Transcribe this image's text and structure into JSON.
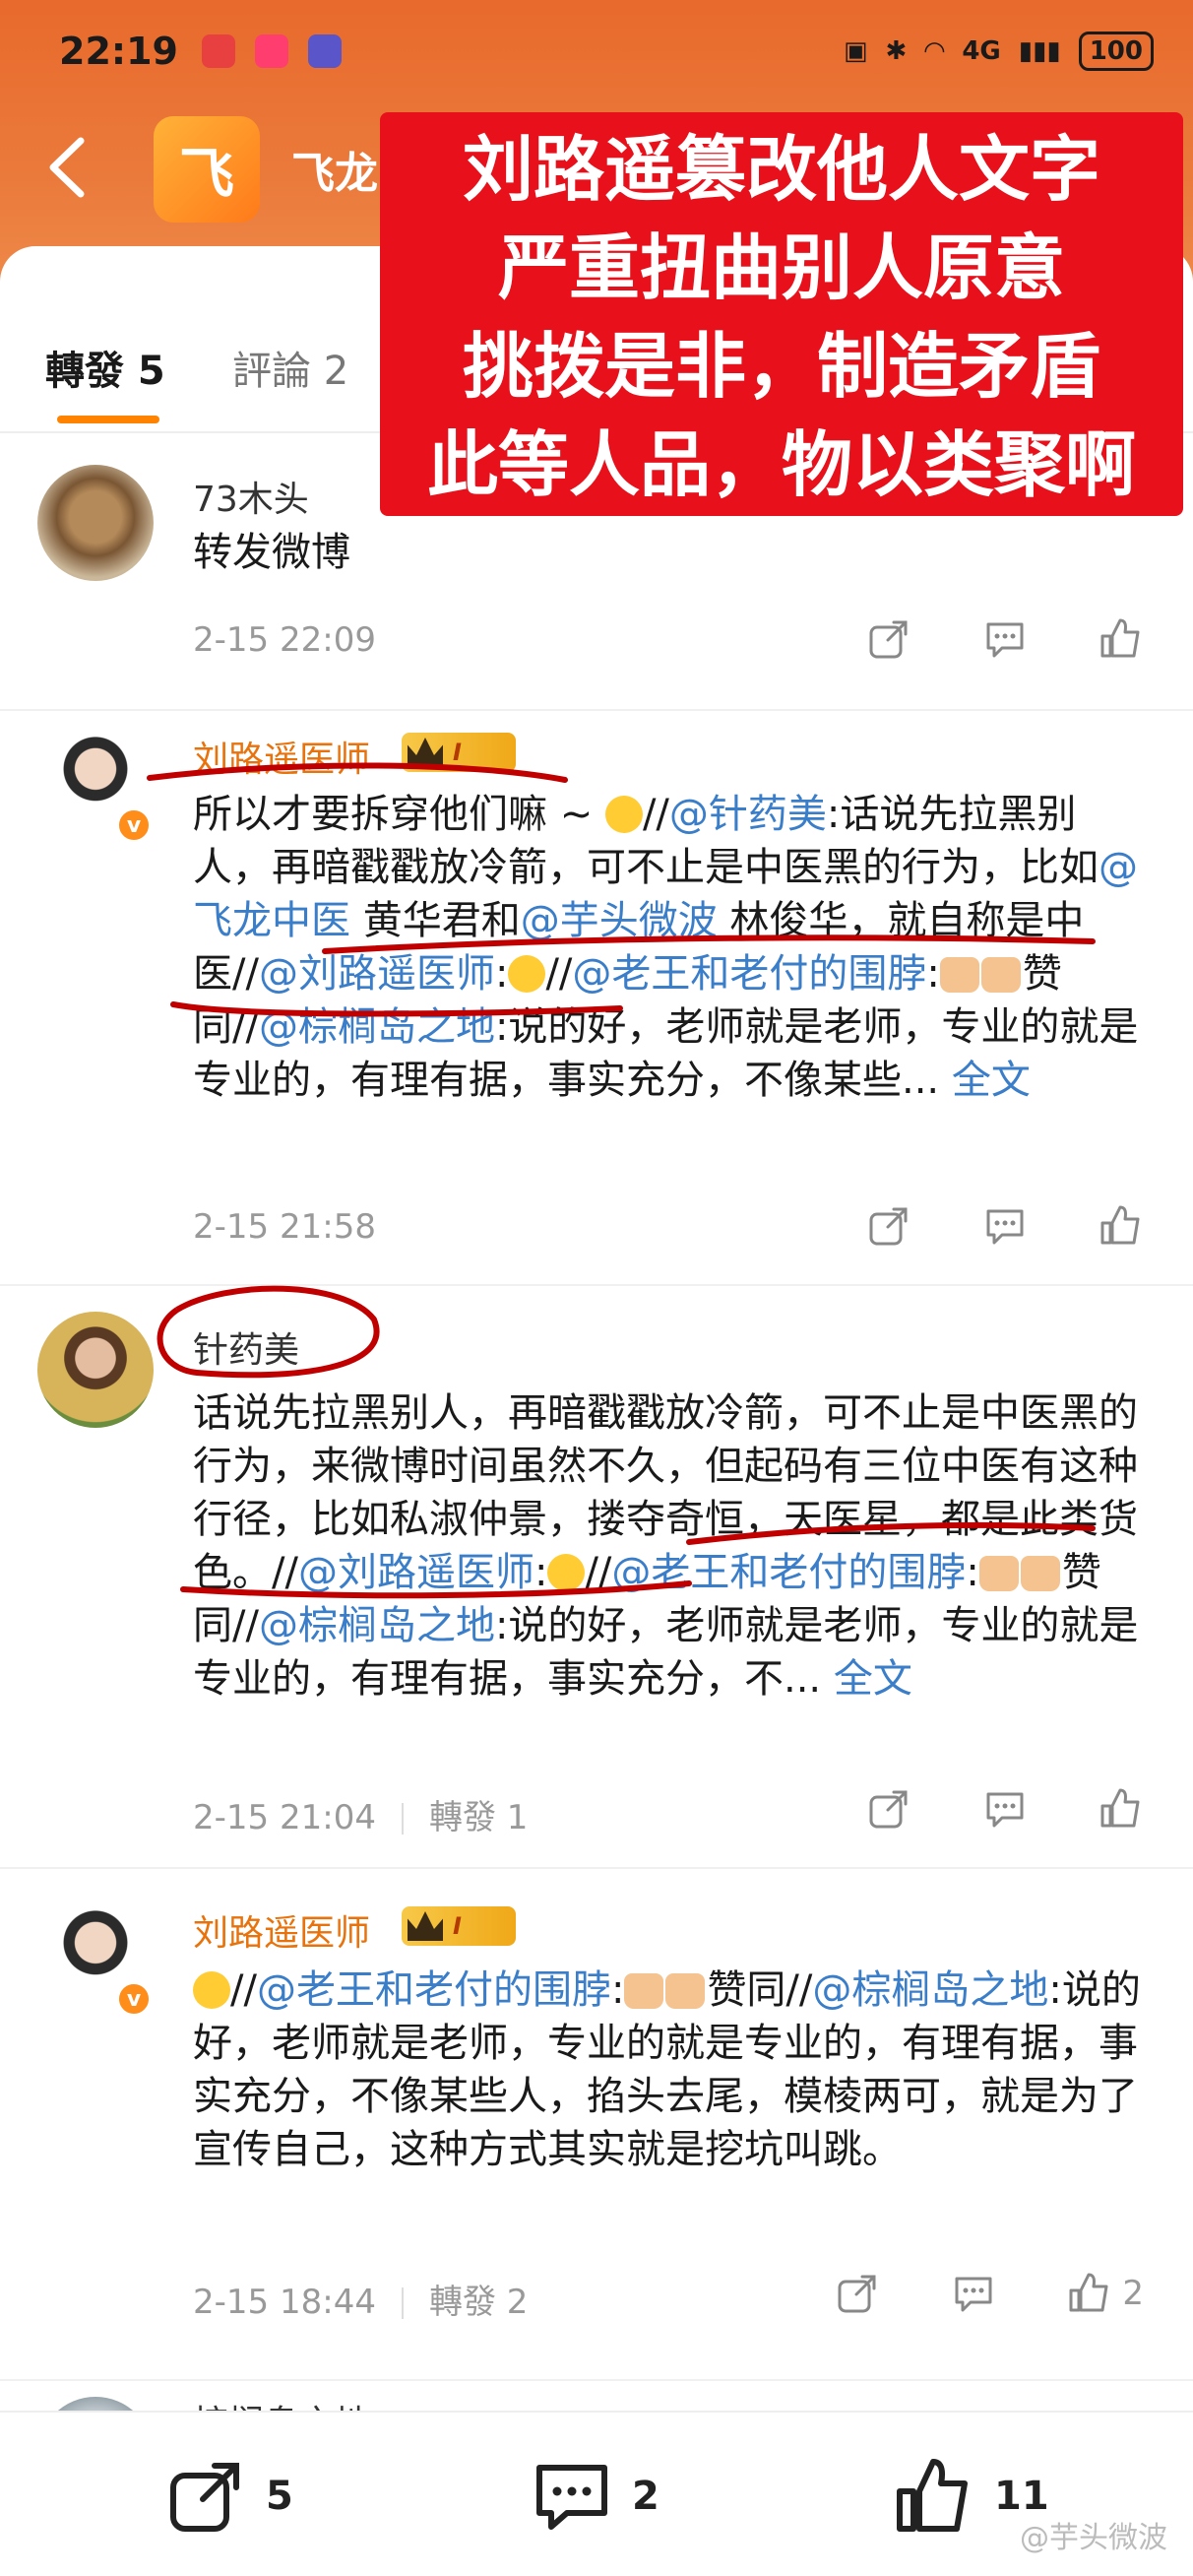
{
  "status": {
    "time": "22:19",
    "network": "4G",
    "battery": "100"
  },
  "header": {
    "app_name": "飞龙",
    "logo_char": "飞"
  },
  "tabs": {
    "repost": "轉發 5",
    "comments": "評論 2"
  },
  "overlay": {
    "lines": [
      "刘路遥篡改他人文字",
      "严重扭曲别人原意",
      "挑拨是非，制造矛盾",
      "此等人品，物以类聚啊"
    ]
  },
  "posts": [
    {
      "name": "73木头",
      "text": "转发微博",
      "time": "2-15 22:09"
    },
    {
      "name": "刘路遥医师",
      "level": "I",
      "text": {
        "p1": "所以才要拆穿他们嘛 ~ ",
        "p2": "//",
        "at1": "@针药美",
        "p3": ":话说先拉黑别人，再暗戳戳放冷箭，可不止是中医黑的行为，比如",
        "at2": "@飞龙中医",
        "p4": " 黄华君和",
        "at3": "@芋头微波",
        "p5": " 林俊华，就自称是中医//",
        "at4": "@刘路遥医师",
        "p6": ":",
        "p7": "//",
        "at5": "@老王和老付的围脖",
        "p8": ":",
        "p9": "赞同//",
        "at6": "@棕榈岛之地",
        "p10": ":说的好，老师就是老师，专业的就是专业的，有理有据，事实充分，不像某些... ",
        "more": "全文"
      },
      "time": "2-15 21:58"
    },
    {
      "name": "针药美",
      "text": {
        "p1": "话说先拉黑别人，再暗戳戳放冷箭，可不止是中医黑的行为，来微博时间虽然不久，但起码有三位中医有这种行径，比如私淑仲景，搂夺奇恒，天医星，都是此类货色。//",
        "at1": "@刘路遥医师",
        "p2": ":",
        "p3": "//",
        "at2": "@老王和老付的围脖",
        "p4": ":",
        "p5": "赞同//",
        "at3": "@棕榈岛之地",
        "p6": ":说的好，老师就是老师，专业的就是专业的，有理有据，事实充分，不... ",
        "more": "全文"
      },
      "time": "2-15 21:04",
      "reposts": "轉發 1"
    },
    {
      "name": "刘路遥医师",
      "level": "I",
      "text": {
        "p1": "//",
        "at1": "@老王和老付的围脖",
        "p2": ":",
        "p3": "赞同//",
        "at2": "@棕榈岛之地",
        "p4": ":说的好，老师就是老师，专业的就是专业的，有理有据，事实充分，不像某些人，掐头去尾，模棱两可，就是为了宣传自己，这种方式其实就是挖坑叫跳。"
      },
      "time": "2-15 18:44",
      "reposts": "轉發 2",
      "likes": "2"
    },
    {
      "name": "棕榈岛之地"
    }
  ],
  "bottom": {
    "reposts": "5",
    "comments": "2",
    "likes": "11"
  },
  "watermark": "@芋头微波",
  "colors": {
    "accent": "#ff8200",
    "link": "#3a7dc9",
    "overlay": "#e7101b",
    "ink": "#c00000"
  }
}
